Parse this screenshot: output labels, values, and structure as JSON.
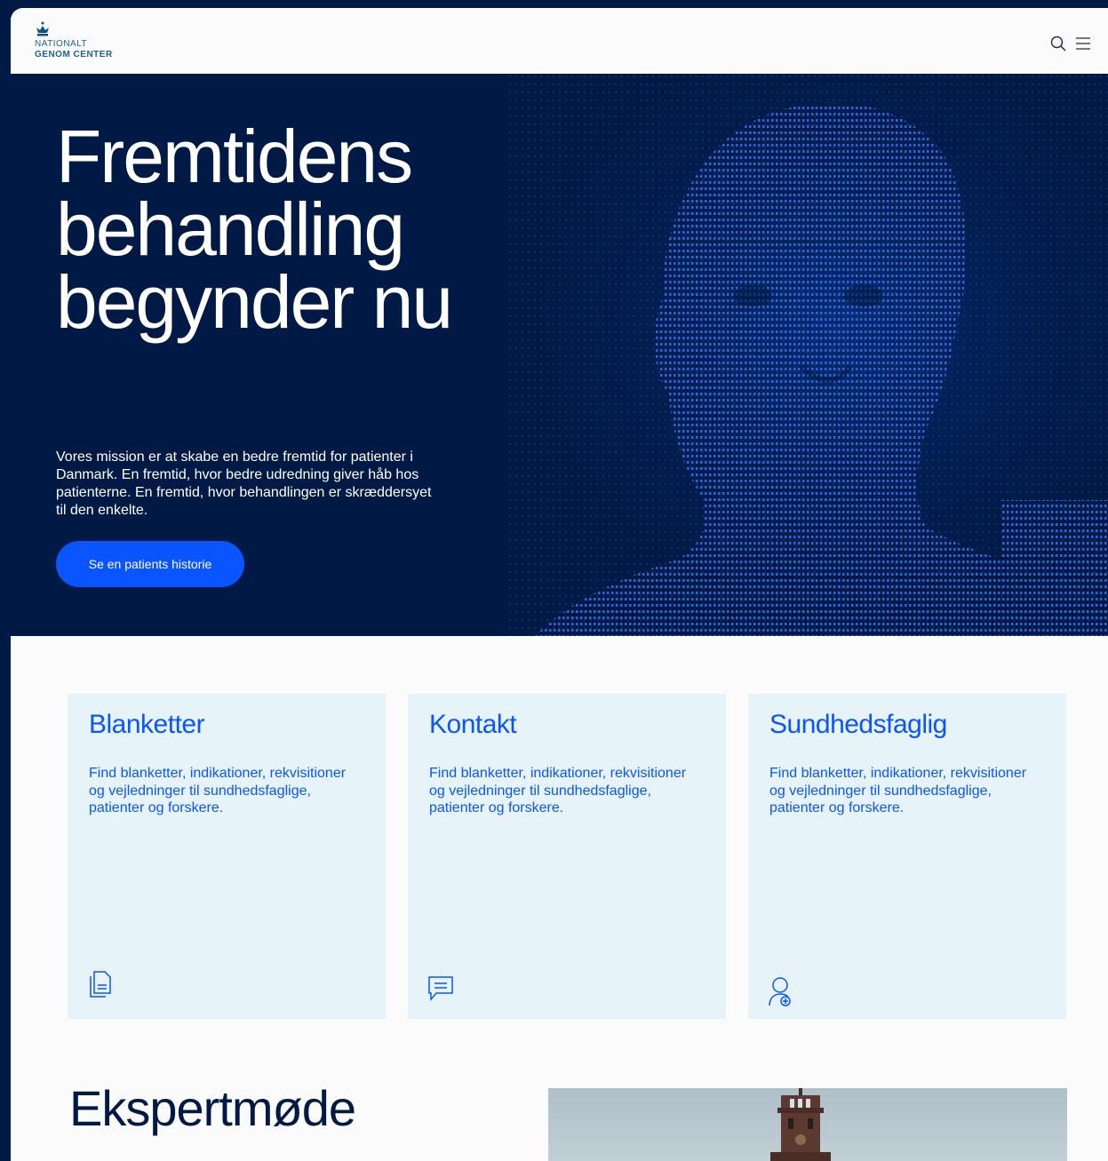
{
  "brand": {
    "logo_line1": "NATIONALT",
    "logo_line2": "GENOM CENTER",
    "icon": "crown-icon"
  },
  "header": {
    "search_icon": "search-icon",
    "menu_icon": "hamburger-menu-icon"
  },
  "hero": {
    "title_lines": [
      "Fremtidens",
      "behandling",
      "begynder nu"
    ],
    "text": "Vores mission er at skabe en bedre fremtid for patienter i Danmark. En fremtid, hvor bedre udredning giver håb hos patienterne. En fremtid, hvor behandlingen er skræddersyet til den enkelte.",
    "button_label": "Se en patients historie"
  },
  "cards": [
    {
      "title": "Blanketter",
      "text": "Find blanketter, indikationer, rekvisitioner og vejledninger til sundhedsfaglige, patienter og forskere.",
      "icon": "document-icon"
    },
    {
      "title": "Kontakt",
      "text": "Find blanketter, indikationer, rekvisitioner og vejledninger til sundhedsfaglige, patienter og forskere.",
      "icon": "chat-bubble-icon"
    },
    {
      "title": "Sundhedsfaglig",
      "text": "Find blanketter, indikationer, rekvisitioner og vejledninger til sundhedsfaglige, patienter og forskere.",
      "icon": "user-add-icon"
    }
  ],
  "section": {
    "title": "Ekspertmøde"
  },
  "colors": {
    "navy": "#001a45",
    "accent_blue": "#0a55ff",
    "card_bg": "#e6f4fa",
    "page_bg": "#fbfbfc"
  }
}
